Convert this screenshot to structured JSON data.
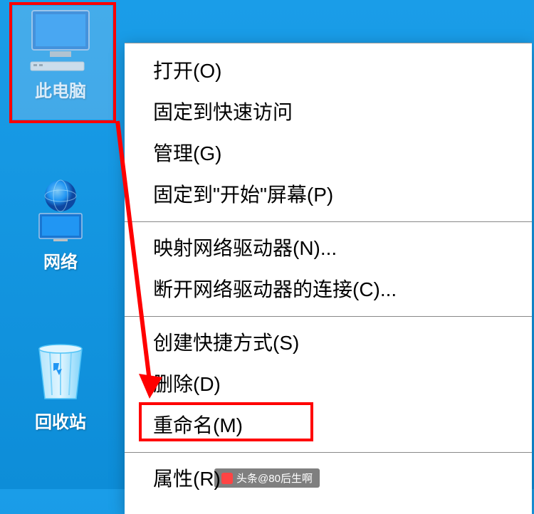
{
  "desktop": {
    "this_pc_label": "此电脑",
    "network_label": "网络",
    "recycle_bin_label": "回收站"
  },
  "context_menu": {
    "open": "打开(O)",
    "pin_quick_access": "固定到快速访问",
    "manage": "管理(G)",
    "pin_start": "固定到\"开始\"屏幕(P)",
    "map_network_drive": "映射网络驱动器(N)...",
    "disconnect_network_drive": "断开网络驱动器的连接(C)...",
    "create_shortcut": "创建快捷方式(S)",
    "delete": "删除(D)",
    "rename": "重命名(M)",
    "properties": "属性(R)"
  },
  "watermark": {
    "text": "头条@80后生啊"
  }
}
